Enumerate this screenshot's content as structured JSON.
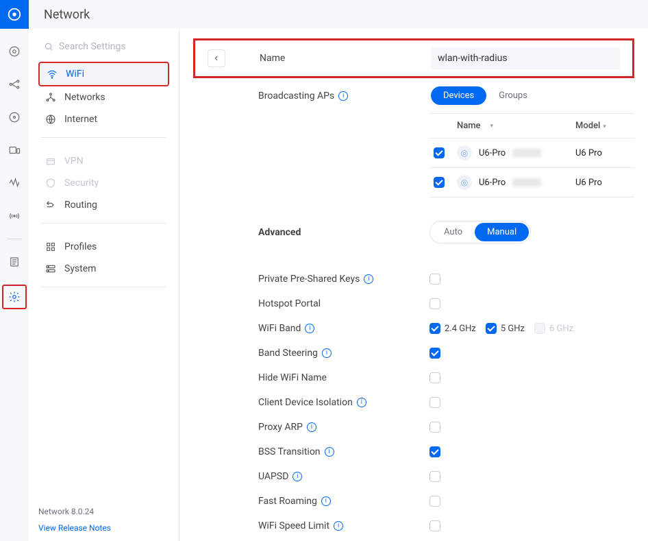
{
  "header": {
    "title": "Network"
  },
  "search": {
    "placeholder": "Search Settings"
  },
  "sidebar": {
    "items": [
      {
        "label": "WiFi"
      },
      {
        "label": "Networks"
      },
      {
        "label": "Internet"
      },
      {
        "label": "VPN"
      },
      {
        "label": "Security"
      },
      {
        "label": "Routing"
      },
      {
        "label": "Profiles"
      },
      {
        "label": "System"
      }
    ],
    "version": "Network 8.0.24",
    "release_link": "View Release Notes"
  },
  "form": {
    "name_label": "Name",
    "name_value": "wlan-with-radius",
    "broadcasting_label": "Broadcasting APs",
    "tabs": {
      "devices": "Devices",
      "groups": "Groups"
    },
    "table": {
      "col_name": "Name",
      "col_model": "Model",
      "rows": [
        {
          "name": "U6-Pro",
          "model": "U6 Pro"
        },
        {
          "name": "U6-Pro",
          "model": "U6 Pro"
        }
      ]
    },
    "advanced_label": "Advanced",
    "adv_tabs": {
      "auto": "Auto",
      "manual": "Manual"
    },
    "options": {
      "ppsk": "Private Pre-Shared Keys",
      "hotspot": "Hotspot Portal",
      "band": "WiFi Band",
      "band_24": "2.4 GHz",
      "band_5": "5 GHz",
      "band_6": "6 GHz",
      "steering": "Band Steering",
      "hide": "Hide WiFi Name",
      "isolation": "Client Device Isolation",
      "proxyarp": "Proxy ARP",
      "bss": "BSS Transition",
      "uapsd": "UAPSD",
      "fastroam": "Fast Roaming",
      "speedlimit": "WiFi Speed Limit"
    }
  }
}
